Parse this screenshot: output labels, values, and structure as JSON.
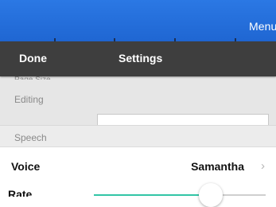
{
  "topbar": {
    "menu_label": "Menu"
  },
  "navbar": {
    "done_label": "Done",
    "title": "Settings"
  },
  "settings": {
    "page_size_label": "Page Size",
    "editing_label": "Editing",
    "speech_section_label": "Speech",
    "voice": {
      "label": "Voice",
      "value": "Samantha"
    },
    "rate": {
      "label": "Rate",
      "value": 0.68
    }
  },
  "icons": {
    "voice_chevron": "chevron-right-icon"
  },
  "colors": {
    "topbar": "#2b78e4",
    "navbar": "#3e3e3e",
    "slider_fill": "#32c5a6"
  }
}
